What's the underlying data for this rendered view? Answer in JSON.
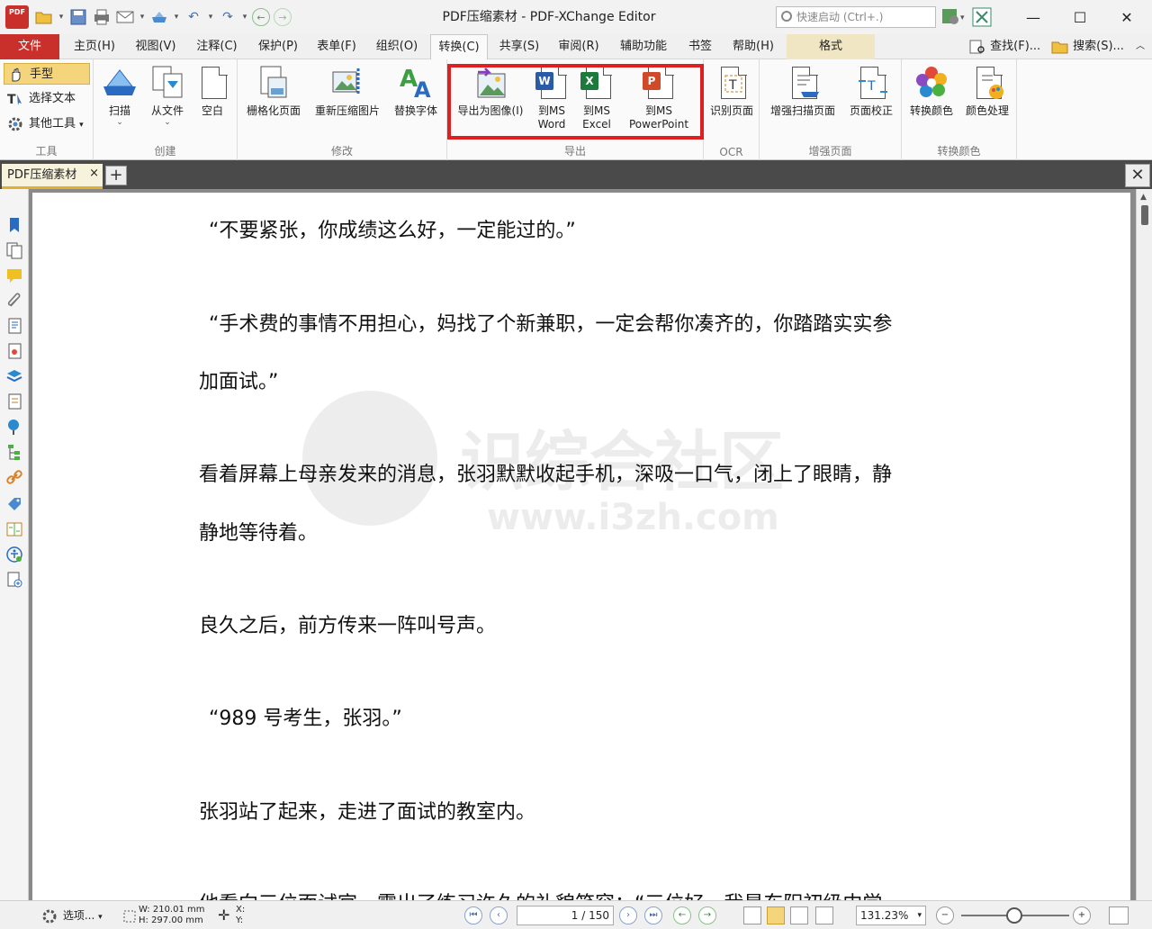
{
  "window": {
    "title": "PDF压缩素材 - PDF-XChange Editor",
    "app_icon_label": "PDF",
    "quick_launch_placeholder": "快速启动 (Ctrl+.)"
  },
  "menu": {
    "file": "文件",
    "tabs": [
      "主页(H)",
      "视图(V)",
      "注释(C)",
      "保护(P)",
      "表单(F)",
      "组织(O)",
      "转换(C)",
      "共享(S)",
      "审阅(R)",
      "辅助功能",
      "书签",
      "帮助(H)",
      "格式"
    ],
    "active_tab": "转换(C)",
    "find": "查找(F)...",
    "search": "搜索(S)..."
  },
  "ribbon": {
    "tools": {
      "label": "工具",
      "items": [
        "手型",
        "选择文本",
        "其他工具"
      ]
    },
    "create": {
      "label": "创建",
      "items": [
        "扫描",
        "从文件",
        "空白"
      ]
    },
    "modify": {
      "label": "修改",
      "items": [
        "栅格化页面",
        "重新压缩图片",
        "替换字体"
      ]
    },
    "export": {
      "label": "导出",
      "image": "导出为图像(I)",
      "word_line1": "到MS",
      "word_line2": "Word",
      "excel_line1": "到MS",
      "excel_line2": "Excel",
      "ppt_line1": "到MS",
      "ppt_line2": "PowerPoint"
    },
    "ocr": {
      "label": "OCR",
      "items": [
        "识别页面"
      ]
    },
    "enhance": {
      "label": "增强页面",
      "items": [
        "增强扫描页面",
        "页面校正"
      ]
    },
    "color": {
      "label": "转换颜色",
      "items": [
        "转换颜色",
        "颜色处理"
      ]
    }
  },
  "document": {
    "tab_name": "PDF压缩素材",
    "paragraphs": [
      "“不要紧张，你成绩这么好，一定能过的。”",
      "“手术费的事情不用担心，妈找了个新兼职，一定会帮你凑齐的，你踏踏实实参",
      "加面试。”",
      "看着屏幕上母亲发来的消息，张羽默默收起手机，深吸一口气，闭上了眼睛，静",
      "静地等待着。",
      "良久之后，前方传来一阵叫号声。",
      "“989 号考生，张羽。”",
      "张羽站了起来，走进了面试的教室内。",
      "他看向三位面试官，露出了练习许久的礼貌笑容：“三位好，我是东阳初级中学"
    ],
    "watermark_title": "识综合社区",
    "watermark_url": "www.i3zh.com"
  },
  "statusbar": {
    "options": "选项...",
    "width": "W: 210.01 mm",
    "height": "H: 297.00 mm",
    "x": "X:",
    "y": "Y:",
    "page_current": "1",
    "page_total": "/ 150",
    "zoom": "131.23%"
  }
}
